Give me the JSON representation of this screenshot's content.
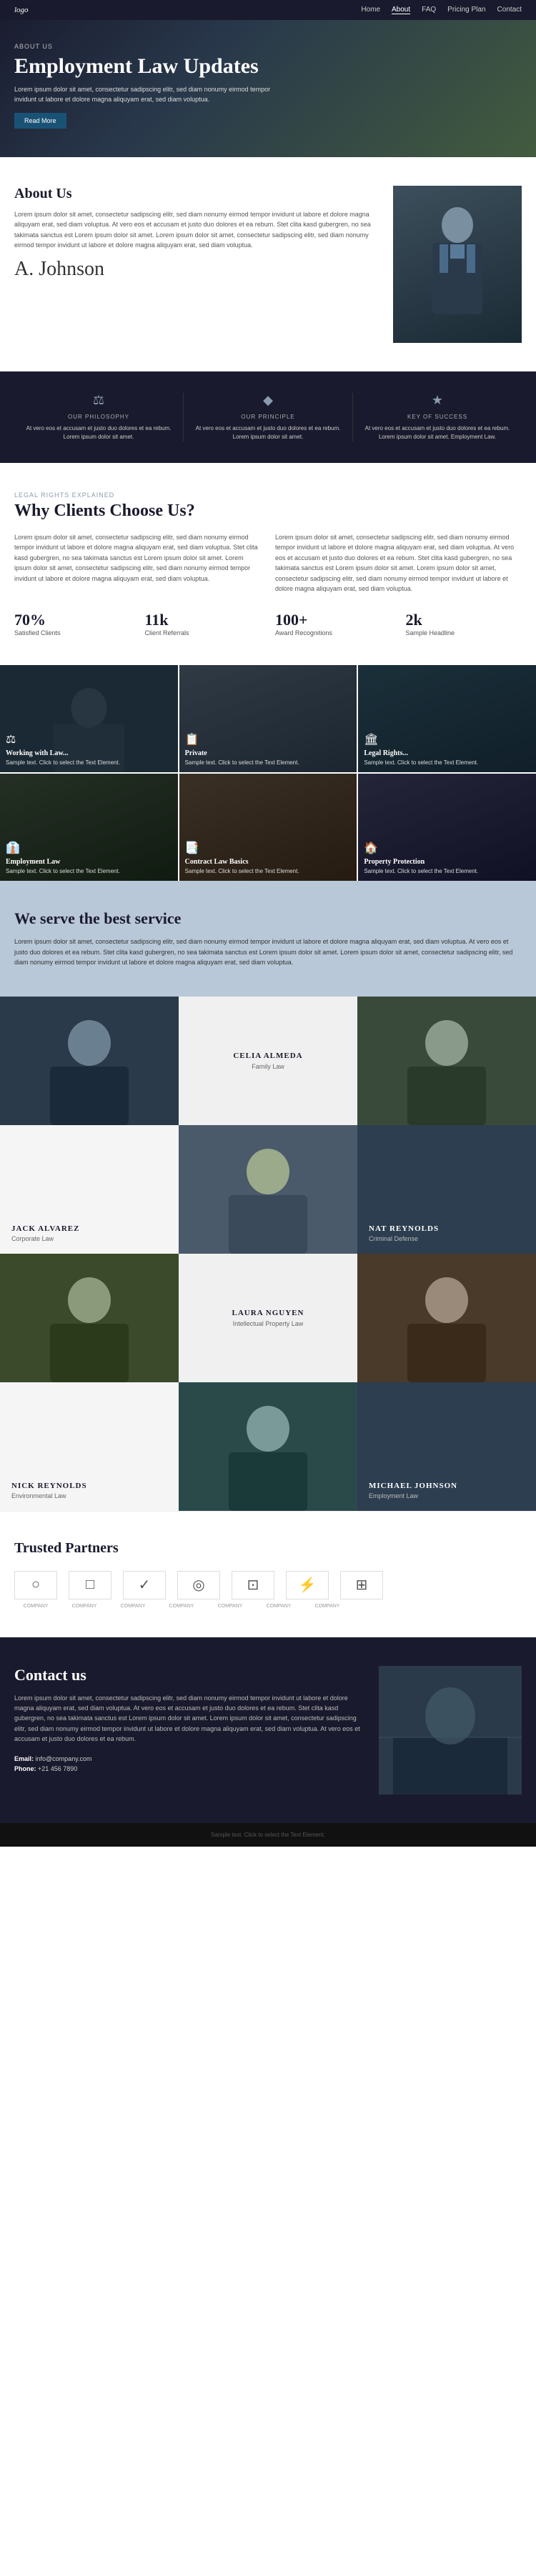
{
  "nav": {
    "logo": "logo",
    "links": [
      "Home",
      "About",
      "FAQ",
      "Pricing Plan",
      "Contact"
    ],
    "active": "About"
  },
  "hero": {
    "label": "ABOUT US",
    "title": "Employment Law Updates",
    "text": "Lorem ipsum dolor sit amet, consectetur sadipscing elitr, sed diam nonumy eirmod tempor invidunt ut labore et dolore magna aliquyam erat, sed diam voluptua.",
    "btn": "Read More"
  },
  "about": {
    "title": "About Us",
    "para1": "Lorem ipsum dolor sit amet, consectetur sadipscing elitr, sed diam nonumy eirmod tempor invidunt ut labore et dolore magna aliquyam erat, sed diam voluptua. At vero eos et accusam et justo duo dolores et ea rebum. Stet clita kasd gubergren, no sea takimata sanctus est Lorem ipsum dolor sit amet. Lorem ipsum dolor sit amet, consectetur sadipscing elitr, sed diam nonumy eirmod tempor invidunt ut labore et dolore magna aliquyam erat, sed diam voluptua.",
    "signature": "A. Johnson"
  },
  "philosophy": {
    "items": [
      {
        "icon": "⚖",
        "label": "OUR PHILOSOPHY",
        "text": "At vero eos et accusam et justo duo dolores et ea rebum. Lorem ipsum dolor sit amet."
      },
      {
        "icon": "🔷",
        "label": "OUR PRINCIPLE",
        "text": "At vero eos et accusam et justo duo dolores et ea rebum. Lorem ipsum dolor sit amet."
      },
      {
        "icon": "🏆",
        "label": "KEY OF SUCCESS",
        "text": "At vero eos et accusam et justo duo dolores et ea rebum. Lorem ipsum dolor sit amet. Employment Law."
      }
    ]
  },
  "why": {
    "label": "LEGAL RIGHTS EXPLAINED",
    "title": "Why Clients Choose Us?",
    "col1": "Lorem ipsum dolor sit amet, consectetur sadipscing elitr, sed diam nonumy eirmod tempor invidunt ut labore et dolore magna aliquyam erat, sed diam voluptua. Stet clita kasd gubergren, no sea takimata sanctus est Lorem ipsum dolor sit amet. Lorem ipsum dolor sit amet, consectetur sadipscing elitr, sed diam nonumy eirmod tempor invidunt ut labore et dolore magna aliquyam erat, sed diam voluptua.",
    "col2": "Lorem ipsum dolor sit amet, consectetur sadipscing elitr, sed diam nonumy eirmod tempor invidunt ut labore et dolore magna aliquyam erat, sed diam voluptua. At vero eos et accusam et justo duo dolores et ea rebum. Stet clita kasd gubergren, no sea takimata sanctus est Lorem ipsum dolor sit amet. Lorem ipsum dolor sit amet, consectetur sadipscing elitr, sed diam nonumy eirmod tempor invidunt ut labore et dolore magna aliquyam erat, sed diam voluptua.",
    "stats": [
      {
        "num": "70%",
        "label": "Satisfied Clients"
      },
      {
        "num": "11k",
        "label": "Client Referrals"
      },
      {
        "num": "100+",
        "label": "Award Recognitions"
      },
      {
        "num": "2k",
        "label": "Sample Headline"
      }
    ]
  },
  "cards": [
    {
      "icon": "⚖",
      "title": "Working with Law...",
      "text": "Sample text. Click to select the Text Element."
    },
    {
      "icon": "📋",
      "title": "Private",
      "text": "Sample text. Click to select the Text Element."
    },
    {
      "icon": "🏛",
      "title": "Legal Rights...",
      "text": "Sample text. Click to select the Text Element."
    },
    {
      "icon": "👔",
      "title": "Employment Law",
      "text": "Sample text. Click to select the Text Element."
    },
    {
      "icon": "📑",
      "title": "Contract Law Basics",
      "text": "Sample text. Click to select the Text Element."
    },
    {
      "icon": "🏠",
      "title": "Property Protection",
      "text": "Sample text. Click to select the Text Element."
    }
  ],
  "service": {
    "title": "We serve the best service",
    "text": "Lorem ipsum dolor sit amet, consectetur sadipscing elitr, sed diam nonumy eirmod tempor invidunt ut labore et dolore magna aliquyam erat, sed diam voluptua. At vero eos et justo duo dolores et ea rebum. Stet clita kasd gubergren, no sea takimata sanctus est Lorem ipsum dolor sit amet. Lorem ipsum dolor sit amet, consectetur sadipscing elitr, sed diam nonumy eirmod tempor invidunt ut labore et dolore magna aliquyam erat, sed diam voluptua."
  },
  "team": [
    {
      "name": "CELIA ALMEDA",
      "role": "Family Law",
      "position": "center-top",
      "bg": "1"
    },
    {
      "name": "JACK ALVAREZ",
      "role": "Corporate Law",
      "position": "left",
      "bg": "2"
    },
    {
      "name": "NAT REYNOLDS",
      "role": "Criminal Defense",
      "position": "right",
      "bg": "3"
    },
    {
      "name": "LAURA NGUYEN",
      "role": "Intellectual Property Law",
      "position": "center-mid",
      "bg": "4"
    },
    {
      "name": "NICK REYNOLDS",
      "role": "Environmental Law",
      "position": "left",
      "bg": "5"
    },
    {
      "name": "MICHAEL JOHNSON",
      "role": "Employment Law",
      "position": "right",
      "bg": "6"
    }
  ],
  "partners": {
    "title": "Trusted Partners",
    "logos": [
      "COMPANY",
      "COMPANY",
      "COMPANY",
      "COMPANY",
      "COMPANY",
      "COMPANY",
      "COMPANY"
    ]
  },
  "contact": {
    "title": "Contact us",
    "text": "Lorem ipsum dolor sit amet, consectetur sadipscing elitr, sed diam nonumy eirmod tempor invidunt ut labore et dolore magna aliquyam erat, sed diam voluptua. At vero eos et accusam et justo duo dolores et ea rebum. Stet clita kasd gubergren, no sea takimata sanctus est Lorem ipsum dolor sit amet. Lorem ipsum dolor sit amet, consectetur sadipscing elitr, sed diam nonumy eirmod tempor invidunt ut labore et dolore magna aliquyam erat, sed diam voluptua. At vero eos et accusam et justo duo dolores et ea rebum.",
    "email_label": "Email:",
    "email": "info@company.com",
    "phone_label": "Phone:",
    "phone": "+21 456 7890"
  },
  "footer": {
    "text": "Sample text. Click to select the Text Element."
  }
}
